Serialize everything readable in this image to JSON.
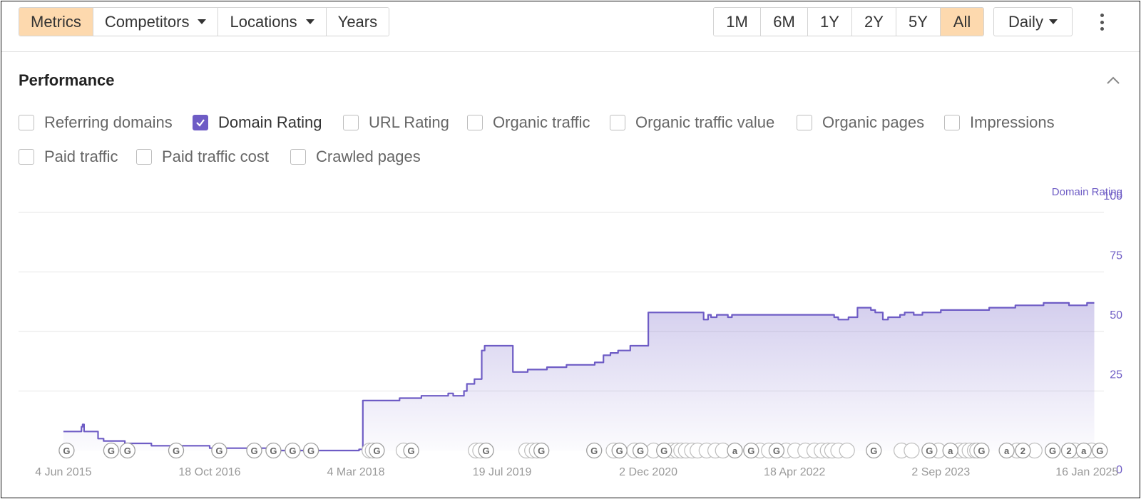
{
  "toolbar": {
    "left_buttons": [
      {
        "label": "Metrics",
        "active": true,
        "dropdown": false
      },
      {
        "label": "Competitors",
        "active": false,
        "dropdown": true
      },
      {
        "label": "Locations",
        "active": false,
        "dropdown": true
      },
      {
        "label": "Years",
        "active": false,
        "dropdown": false
      }
    ],
    "ranges": [
      {
        "label": "1M",
        "active": false
      },
      {
        "label": "6M",
        "active": false
      },
      {
        "label": "1Y",
        "active": false
      },
      {
        "label": "2Y",
        "active": false
      },
      {
        "label": "5Y",
        "active": false
      },
      {
        "label": "All",
        "active": true
      }
    ],
    "interval_label": "Daily",
    "more_icon": "vertical-dots-icon"
  },
  "section": {
    "title": "Performance",
    "collapse_icon": "chevron-up-icon"
  },
  "metrics_row1": [
    {
      "label": "Referring domains",
      "checked": false
    },
    {
      "label": "Domain Rating",
      "checked": true
    },
    {
      "label": "URL Rating",
      "checked": false
    },
    {
      "label": "Organic traffic",
      "checked": false
    },
    {
      "label": "Organic traffic value",
      "checked": false
    },
    {
      "label": "Organic pages",
      "checked": false
    },
    {
      "label": "Impressions",
      "checked": false
    }
  ],
  "metrics_row2": [
    {
      "label": "Paid traffic",
      "checked": false
    },
    {
      "label": "Paid traffic cost",
      "checked": false
    },
    {
      "label": "Crawled pages",
      "checked": false
    }
  ],
  "colors": {
    "accent": "#6e5cc5",
    "active_button": "#fdd9ae",
    "axis_text": "#6e5cc5",
    "grid": "#e6e6e6",
    "date_text": "#999999"
  },
  "chart_data": {
    "type": "line",
    "series": [
      {
        "name": "Domain Rating",
        "x": [
          "2015-06-04",
          "2015-08-01",
          "2015-08-05",
          "2015-08-09",
          "2015-08-14",
          "2015-10-01",
          "2015-10-20",
          "2016-01-01",
          "2016-04-01",
          "2016-10-18",
          "2017-06-01",
          "2018-02-01",
          "2018-03-15",
          "2018-03-28",
          "2018-04-10",
          "2018-08-01",
          "2018-09-01",
          "2018-10-15",
          "2019-01-15",
          "2019-02-01",
          "2019-03-10",
          "2019-03-20",
          "2019-04-15",
          "2019-05-10",
          "2019-05-20",
          "2019-06-15",
          "2019-08-25",
          "2019-09-01",
          "2019-10-15",
          "2019-11-10",
          "2019-12-20",
          "2020-01-25",
          "2020-02-25",
          "2020-03-20",
          "2020-04-01",
          "2020-05-15",
          "2020-06-01",
          "2020-07-01",
          "2020-07-25",
          "2020-08-20",
          "2020-10-01",
          "2020-12-02",
          "2021-06-10",
          "2021-06-25",
          "2021-07-05",
          "2021-07-25",
          "2021-09-01",
          "2021-09-15",
          "2021-10-01",
          "2021-11-01",
          "2022-01-10",
          "2022-04-18",
          "2022-06-01",
          "2022-09-01",
          "2022-09-15",
          "2022-10-20",
          "2022-11-20",
          "2023-01-05",
          "2023-01-20",
          "2023-02-15",
          "2023-03-05",
          "2023-03-25",
          "2023-04-15",
          "2023-05-01",
          "2023-06-01",
          "2023-07-01",
          "2023-08-01",
          "2023-09-02",
          "2023-10-15",
          "2023-11-20",
          "2024-01-10",
          "2024-02-15",
          "2024-04-01",
          "2024-05-15",
          "2024-07-01",
          "2024-08-20",
          "2024-10-01",
          "2024-11-15",
          "2025-01-16",
          "2025-02-10"
        ],
        "values": [
          8,
          8,
          10,
          11,
          8,
          5,
          4,
          3,
          2,
          1,
          0,
          0,
          0.5,
          21,
          21,
          22,
          22,
          23,
          24,
          23,
          25,
          28,
          30,
          42,
          44,
          44,
          33,
          33,
          34,
          34,
          35,
          35,
          36,
          36,
          36,
          36,
          37,
          40,
          41,
          42,
          44,
          58,
          55,
          57,
          56,
          57,
          56,
          57,
          57,
          57,
          57,
          57,
          57,
          56,
          55,
          56,
          60,
          59,
          58,
          55,
          56,
          56,
          57,
          58,
          57,
          58,
          58,
          59,
          59,
          59,
          59,
          60,
          60,
          61,
          61,
          62,
          62,
          61,
          62,
          62
        ]
      }
    ],
    "x_ticks": [
      "4 Jun 2015",
      "18 Oct 2016",
      "4 Mar 2018",
      "19 Jul 2019",
      "2 Dec 2020",
      "18 Apr 2022",
      "2 Sep 2023",
      "16 Jan 2025"
    ],
    "x_range": [
      "2015-01-01",
      "2025-03-15"
    ],
    "y_label": "Domain Rating",
    "y_ticks": [
      "100",
      "75",
      "50",
      "25",
      "0"
    ],
    "ylim": [
      0,
      100
    ],
    "y_axis_side": "right",
    "grid": true,
    "area_fill": true,
    "annotations": [
      {
        "label": "G",
        "date": "2015-06-15"
      },
      {
        "label": "G",
        "date": "2015-11-15"
      },
      {
        "label": "G",
        "date": "2016-01-10"
      },
      {
        "label": "G",
        "date": "2016-06-25"
      },
      {
        "label": "G",
        "date": "2016-11-20"
      },
      {
        "label": "G",
        "date": "2017-03-20"
      },
      {
        "label": "G",
        "date": "2017-05-25"
      },
      {
        "label": "G",
        "date": "2017-07-30"
      },
      {
        "label": "G",
        "date": "2017-10-01"
      },
      {
        "label": "G",
        "date": "2018-05-15"
      },
      {
        "label": "G",
        "date": "2018-09-10"
      },
      {
        "label": "G",
        "date": "2019-05-25"
      },
      {
        "label": "G",
        "date": "2019-12-01"
      },
      {
        "label": "G",
        "date": "2020-05-30"
      },
      {
        "label": "G",
        "date": "2020-08-25"
      },
      {
        "label": "G",
        "date": "2020-11-05"
      },
      {
        "label": "G",
        "date": "2021-01-25"
      },
      {
        "label": "a",
        "date": "2021-09-25"
      },
      {
        "label": "G",
        "date": "2021-11-20"
      },
      {
        "label": "G",
        "date": "2022-02-15"
      },
      {
        "label": "G",
        "date": "2023-01-15"
      },
      {
        "label": "G",
        "date": "2023-07-25"
      },
      {
        "label": "a",
        "date": "2023-10-05"
      },
      {
        "label": "G",
        "date": "2024-01-20"
      },
      {
        "label": "a",
        "date": "2024-04-15"
      },
      {
        "label": "2",
        "date": "2024-06-10"
      },
      {
        "label": "G",
        "date": "2024-09-20"
      },
      {
        "label": "2",
        "date": "2024-11-15"
      },
      {
        "label": "a",
        "date": "2025-01-05"
      },
      {
        "label": "G",
        "date": "2025-03-01"
      }
    ],
    "annotation_cluster_dates": [
      "2018-04-20",
      "2018-05-01",
      "2018-08-15",
      "2019-04-20",
      "2019-05-05",
      "2019-10-10",
      "2019-10-30",
      "2019-11-15",
      "2020-08-05",
      "2020-10-15",
      "2020-12-20",
      "2021-02-20",
      "2021-03-10",
      "2021-03-25",
      "2021-04-10",
      "2021-05-01",
      "2021-05-20",
      "2021-06-20",
      "2021-07-20",
      "2021-08-15",
      "2021-12-20",
      "2022-01-20",
      "2022-03-20",
      "2022-04-20",
      "2022-05-25",
      "2022-06-25",
      "2022-07-20",
      "2022-08-10",
      "2022-08-25",
      "2022-09-15",
      "2022-10-15",
      "2023-04-20",
      "2023-05-25",
      "2023-08-25",
      "2023-11-05",
      "2023-11-25",
      "2023-12-10",
      "2023-12-28",
      "2024-01-05",
      "2024-05-20",
      "2024-07-20",
      "2024-12-05",
      "2025-02-01"
    ]
  }
}
